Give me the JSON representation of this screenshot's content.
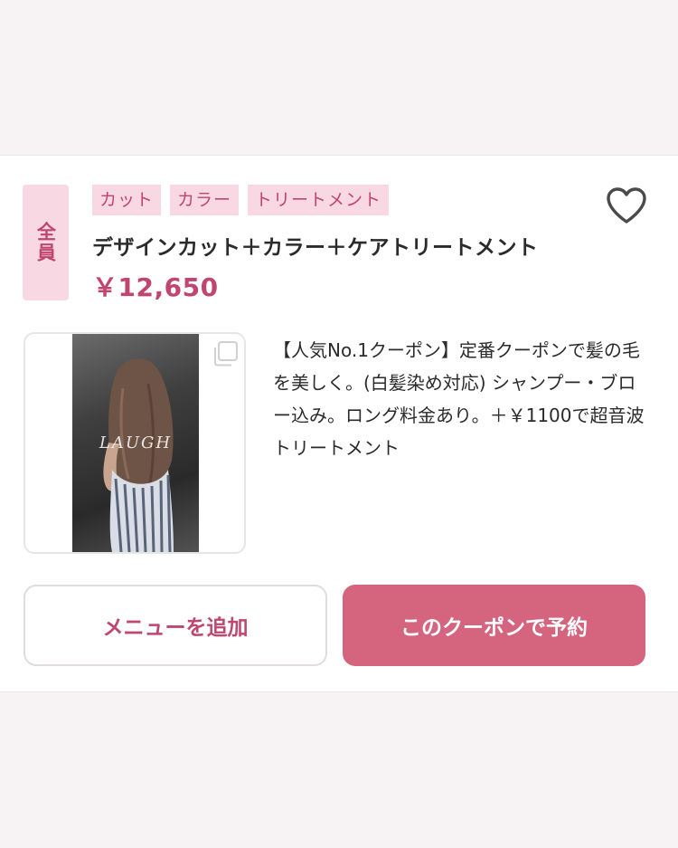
{
  "coupon": {
    "target_badge": "全員",
    "tags": [
      "カット",
      "カラー",
      "トリートメント"
    ],
    "title": "デザインカット＋カラー＋ケアトリートメント",
    "price": "￥12,650",
    "description": "【人気No.1クーポン】定番クーポンで髪の毛を美しく。(白髪染め対応) シャンプー・ブロー込み。ロング料金あり。＋￥1100で超音波トリートメント",
    "photo_watermark": "LAUGH",
    "favorite_icon": "heart-outline-icon",
    "gallery_icon": "gallery-stack-icon"
  },
  "buttons": {
    "add_menu": "メニューを追加",
    "reserve": "このクーポンで予約"
  },
  "colors": {
    "accent": "#c0456f",
    "tag_bg": "#f8d9e3",
    "reserve_bg": "#d5657f",
    "page_bg": "#f7f3f4"
  }
}
